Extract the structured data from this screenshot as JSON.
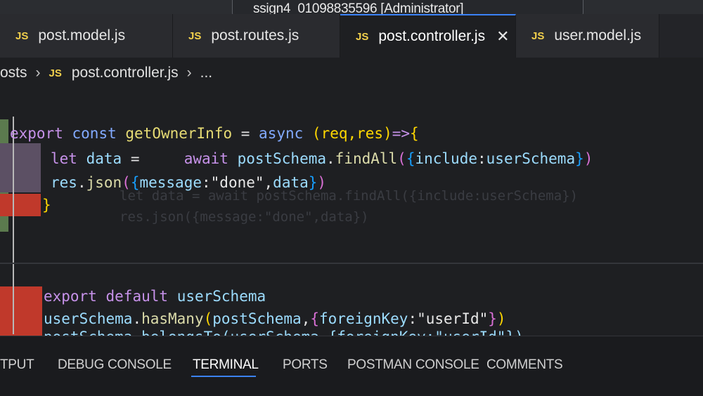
{
  "window": {
    "title": "ssign4_01098835596 [Administrator]"
  },
  "tabs": [
    {
      "label": "post.model.js",
      "badge": "JS",
      "active": false
    },
    {
      "label": "post.routes.js",
      "badge": "JS",
      "active": false
    },
    {
      "label": "post.controller.js",
      "badge": "JS",
      "active": true,
      "close": "✕"
    },
    {
      "label": "user.model.js",
      "badge": "JS",
      "active": false
    }
  ],
  "breadcrumb": {
    "folder": "osts",
    "badge": "JS",
    "file": "post.controller.js",
    "more": "..."
  },
  "code": {
    "l1": {
      "kw1": "export",
      "kw2": "const",
      "name": "getOwnerInfo",
      "op": " = ",
      "kw3": "async",
      "params": "(req,res)",
      "arrow": "=>",
      "brace": "{"
    },
    "l2": {
      "kw": "let",
      "name": "data",
      "op": " =     ",
      "await": "await",
      "obj": "postSchema",
      "dot": ".",
      "method": "findAll",
      "open": "(",
      "ob": "{",
      "prop": "include",
      "colon": ":",
      "val": "userSchema",
      "cb": "}",
      "close": ")"
    },
    "l3": {
      "obj": "res",
      "dot": ".",
      "method": "json",
      "open": "(",
      "ob": "{",
      "prop": "message",
      "colon": ":",
      "str": "\"done\"",
      "comma": ",",
      "val": "data",
      "cb": "}",
      "close": ")"
    },
    "l4": {
      "brace": "}"
    },
    "l5": {
      "kw1": "export",
      "kw2": "default",
      "name": "userSchema"
    },
    "l6": {
      "obj": "userSchema",
      "dot": ".",
      "method": "hasMany",
      "open": "(",
      "arg": "postSchema",
      "comma": ",",
      "ob": "{",
      "prop": "foreignKey",
      "colon": ":",
      "str": "\"userId\"",
      "cb": "}",
      "close": ")"
    },
    "l7": {
      "text": "postSchema.belongsTo(userSchema,{foreignKey:\"userId\"})"
    }
  },
  "panel_tabs": [
    {
      "label": "TPUT",
      "active": false
    },
    {
      "label": "DEBUG CONSOLE",
      "active": false
    },
    {
      "label": "TERMINAL",
      "active": true
    },
    {
      "label": "PORTS",
      "active": false
    },
    {
      "label": "POSTMAN CONSOLE",
      "active": false
    },
    {
      "label": "COMMENTS",
      "active": false
    }
  ],
  "colors": {
    "accent": "#3b82f6",
    "js_badge": "#f2d04c",
    "gutter_added": "#5b7a4e",
    "gutter_modified": "#5c5064",
    "gutter_deleted": "#c0392b"
  }
}
